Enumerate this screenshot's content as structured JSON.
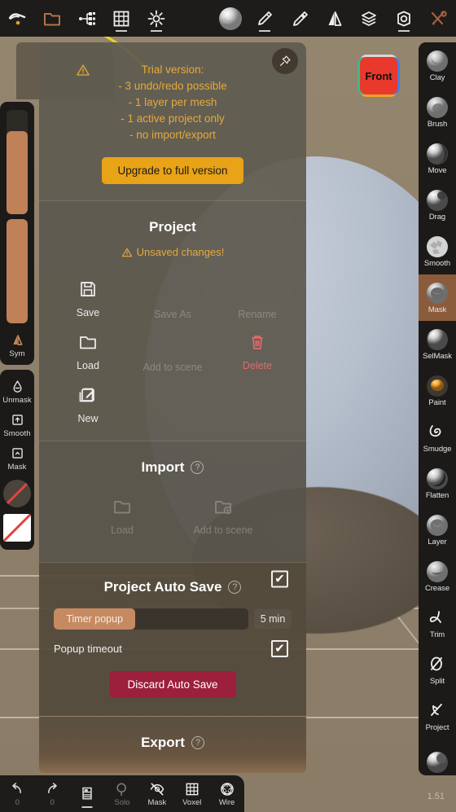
{
  "app": {
    "version": "1.51",
    "viewcube_label": "Front"
  },
  "topbar": {
    "items": [
      {
        "name": "scene-icon",
        "label": "Scene",
        "underline": false
      },
      {
        "name": "folder-icon",
        "label": "Files",
        "underline": false
      },
      {
        "name": "topology-icon",
        "label": "Topology",
        "underline": false
      },
      {
        "name": "grid-icon",
        "label": "Grid",
        "underline": true
      },
      {
        "name": "light-icon",
        "label": "Light",
        "underline": true
      },
      {
        "name": "material-icon",
        "label": "Material",
        "underline": false
      },
      {
        "name": "brush-icon",
        "label": "Brush",
        "underline": true
      },
      {
        "name": "stamp-icon",
        "label": "Stamp",
        "underline": false
      },
      {
        "name": "mirror-icon",
        "label": "Mirror",
        "underline": false
      },
      {
        "name": "layers-icon",
        "label": "Layers",
        "underline": false
      },
      {
        "name": "settings-icon",
        "label": "Settings",
        "underline": true
      },
      {
        "name": "tools-icon",
        "label": "Tools",
        "underline": false
      }
    ]
  },
  "left_sidebar": {
    "sliders": [
      {
        "name": "brush-size-slider",
        "fill_percent": 80
      },
      {
        "name": "brush-intensity-slider",
        "fill_percent": 100
      }
    ],
    "sym_label": "Sym",
    "items": [
      {
        "name": "unmask-button",
        "label": "Unmask",
        "icon": "drop-icon"
      },
      {
        "name": "smooth-button",
        "label": "Smooth",
        "icon": "box-up-icon"
      },
      {
        "name": "mask-button",
        "label": "Mask",
        "icon": "box-caret-icon"
      }
    ],
    "swatches": [
      {
        "name": "material-swatch-round",
        "label": "material"
      },
      {
        "name": "material-swatch-square",
        "label": "material-none"
      }
    ]
  },
  "right_sidebar": {
    "active": "Mask",
    "tools": [
      {
        "label": "Clay",
        "icon": "clay-ball-icon"
      },
      {
        "label": "Brush",
        "icon": "brush-ball-icon"
      },
      {
        "label": "Move",
        "icon": "move-ball-icon"
      },
      {
        "label": "Drag",
        "icon": "drag-ball-icon"
      },
      {
        "label": "Smooth",
        "icon": "smooth-ball-icon"
      },
      {
        "label": "Mask",
        "icon": "mask-ball-icon"
      },
      {
        "label": "SelMask",
        "icon": "selmask-ball-icon"
      },
      {
        "label": "Paint",
        "icon": "paint-ball-icon"
      },
      {
        "label": "Smudge",
        "icon": "smudge-icon"
      },
      {
        "label": "Flatten",
        "icon": "flatten-ball-icon"
      },
      {
        "label": "Layer",
        "icon": "layer-ball-icon"
      },
      {
        "label": "Crease",
        "icon": "crease-ball-icon"
      },
      {
        "label": "Trim",
        "icon": "trim-icon"
      },
      {
        "label": "Split",
        "icon": "split-icon"
      },
      {
        "label": "Project",
        "icon": "project-icon"
      }
    ]
  },
  "bottombar": {
    "undo_label": "0",
    "redo_label": "0",
    "items": [
      {
        "name": "undo-button",
        "label": "0",
        "dim": true,
        "underline": false
      },
      {
        "name": "redo-button",
        "label": "0",
        "dim": true,
        "underline": false
      },
      {
        "name": "subdiv-button",
        "label": "",
        "dim": false,
        "underline": true
      },
      {
        "name": "solo-button",
        "label": "Solo",
        "dim": true,
        "underline": false
      },
      {
        "name": "mask-button",
        "label": "Mask",
        "dim": false,
        "underline": false
      },
      {
        "name": "voxel-button",
        "label": "Voxel",
        "dim": false,
        "underline": false
      },
      {
        "name": "wire-button",
        "label": "Wire",
        "dim": false,
        "underline": false
      }
    ]
  },
  "panel": {
    "pin_icon": "pin-icon",
    "trial": {
      "title": "Trial version:",
      "lines": [
        "- 3 undo/redo possible",
        "- 1 layer per mesh",
        "- 1 active project only",
        "- no import/export"
      ],
      "upgrade_label": "Upgrade to full version"
    },
    "project": {
      "heading": "Project",
      "warning": "Unsaved changes!",
      "actions": [
        {
          "label": "Save",
          "icon": "floppy-icon",
          "state": "enabled"
        },
        {
          "label": "Save As",
          "icon": "none",
          "state": "disabled"
        },
        {
          "label": "Rename",
          "icon": "none",
          "state": "disabled"
        },
        {
          "label": "Load",
          "icon": "folder-open-icon",
          "state": "enabled"
        },
        {
          "label": "Add to scene",
          "icon": "none",
          "state": "disabled"
        },
        {
          "label": "Delete",
          "icon": "trash-icon",
          "state": "danger"
        },
        {
          "label": "New",
          "icon": "new-doc-icon",
          "state": "enabled"
        }
      ]
    },
    "import": {
      "heading": "Import",
      "help": "?",
      "actions": [
        {
          "label": "Load",
          "icon": "folder-open-icon",
          "state": "disabled"
        },
        {
          "label": "Add to scene",
          "icon": "folder-plus-icon",
          "state": "disabled"
        }
      ]
    },
    "autosave": {
      "heading": "Project Auto Save",
      "help": "?",
      "enabled": true,
      "check_glyph": "✔",
      "timer_label": "Timer popup",
      "timer_value": "5 min",
      "timer_fill_percent": 42,
      "popup_timeout_label": "Popup timeout",
      "popup_timeout_enabled": true,
      "discard_label": "Discard Auto Save"
    },
    "export": {
      "heading": "Export",
      "help": "?"
    }
  },
  "colors": {
    "accent_orange": "#e8a317",
    "warn_orange": "#e5a93b",
    "danger_red": "#e2696b",
    "discard_red": "#9c1f3c",
    "slider_brown": "#c68a62",
    "active_tool": "#8b5c3c",
    "panel_bg": "#5f5a50",
    "canvas_bg": "#8d7f69"
  }
}
